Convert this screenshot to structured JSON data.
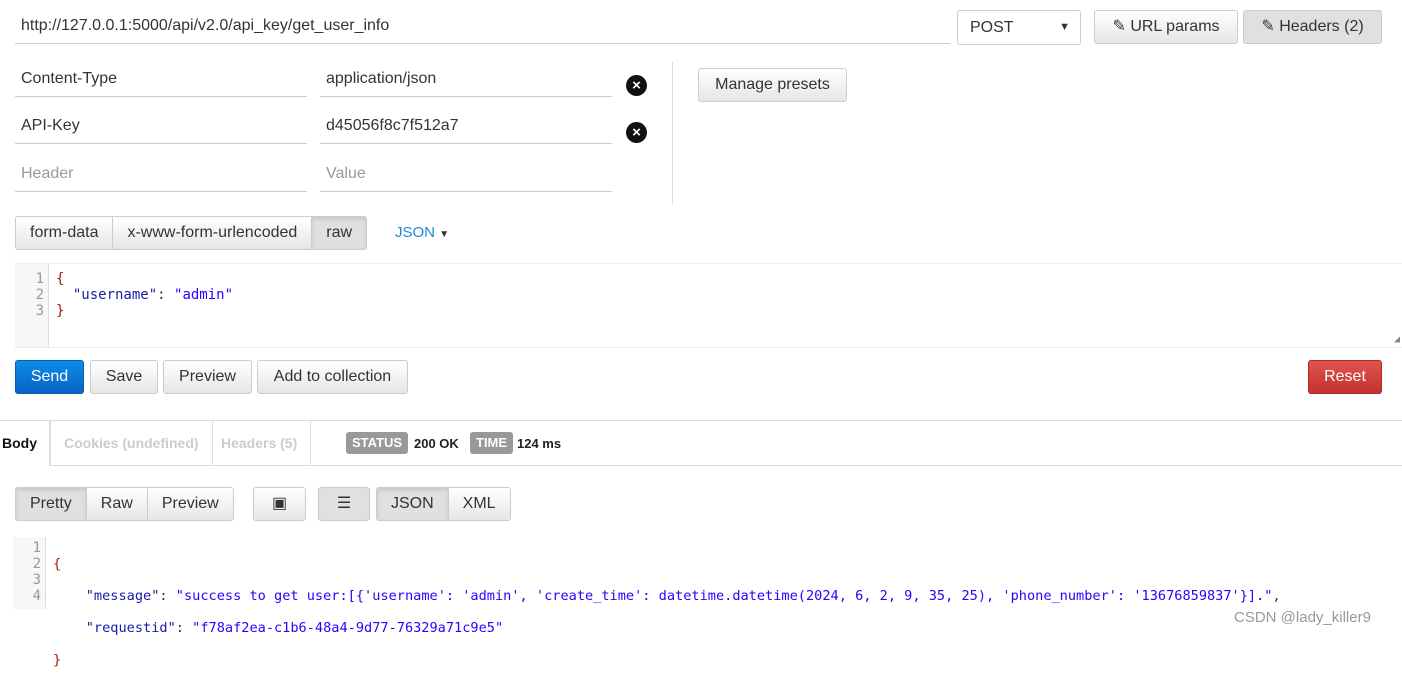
{
  "request": {
    "url": "http://127.0.0.1:5000/api/v2.0/api_key/get_user_info",
    "method": "POST",
    "url_params_label": "URL params",
    "headers_label": "Headers (2)"
  },
  "headers": [
    {
      "key": "Content-Type",
      "value": "application/json"
    },
    {
      "key": "API-Key",
      "value": "d45056f8c7f512a7"
    }
  ],
  "header_placeholder": {
    "key": "Header",
    "value": "Value"
  },
  "manage_presets": "Manage presets",
  "body_tabs": [
    "form-data",
    "x-www-form-urlencoded",
    "raw"
  ],
  "body_format": "JSON",
  "request_body": {
    "line_numbers": [
      "1",
      "2",
      "3"
    ],
    "open": "{",
    "key": "\"username\"",
    "sep": ": ",
    "value": "\"admin\"",
    "close": "}"
  },
  "actions": {
    "send": "Send",
    "save": "Save",
    "preview": "Preview",
    "add": "Add to collection",
    "reset": "Reset"
  },
  "response_tabs": [
    "Body",
    "Cookies (undefined)",
    "Headers (5)"
  ],
  "status": {
    "label": "STATUS",
    "value": "200 OK",
    "time_label": "TIME",
    "time_value": "124 ms"
  },
  "view_tabs": [
    "Pretty",
    "Raw",
    "Preview"
  ],
  "format_tabs": [
    "JSON",
    "XML"
  ],
  "response_body": {
    "line_numbers": [
      "1",
      "2",
      "3",
      "4"
    ],
    "open": "{",
    "k1": "\"message\"",
    "v1": "\"success to get user:[{'username': 'admin', 'create_time': datetime.datetime(2024, 6, 2, 9, 35, 25), 'phone_number': '13676859837'}].\"",
    "k2": "\"requestid\"",
    "v2": "\"f78af2ea-c1b6-48a4-9d77-76329a71c9e5\"",
    "close": "}"
  },
  "watermark": "CSDN @lady_killer9",
  "colors": {
    "send": "#0a6ccf",
    "reset": "#cf3a35",
    "key": "#1a1aa6",
    "string": "#2a00ff"
  }
}
